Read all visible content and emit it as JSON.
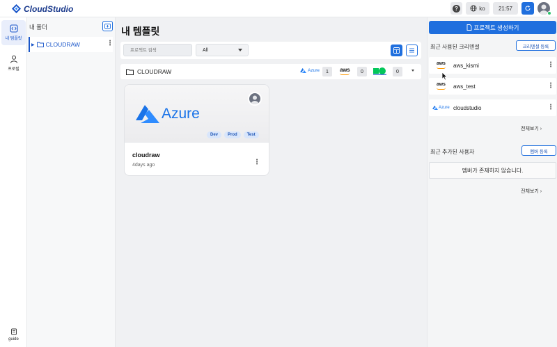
{
  "app": {
    "name": "CloudStudio"
  },
  "header": {
    "help_icon_text": "?",
    "language": "ko",
    "time": "21:57"
  },
  "leftnav": {
    "items": [
      {
        "label": "내 템플릿"
      },
      {
        "label": "프로필"
      }
    ],
    "guide_label": "guide"
  },
  "folders": {
    "title": "내 폴더",
    "items": [
      {
        "name": "CLOUDRAW"
      }
    ]
  },
  "main": {
    "title": "내 템플릿",
    "search_placeholder": "프로젝트 검색",
    "filter_value": "All",
    "folder_row": {
      "name": "CLOUDRAW",
      "providers": [
        {
          "name": "Azure",
          "count": "1"
        },
        {
          "name": "aws",
          "count": "0"
        },
        {
          "name": "ncp",
          "count": "0"
        }
      ]
    },
    "card": {
      "provider_label": "Azure",
      "tags": [
        "Dev",
        "Prod",
        "Test"
      ],
      "name": "cloudraw",
      "time": "4days ago"
    }
  },
  "right": {
    "create_button": "프로젝트 생성하기",
    "cred_section_title": "최근 사용된 크리덴셜",
    "cred_add_button": "크리덴셜 등록",
    "credentials": [
      {
        "provider": "aws",
        "name": "aws_kismi"
      },
      {
        "provider": "aws",
        "name": "aws_test"
      },
      {
        "provider": "Azure",
        "name": "cloudstudio"
      }
    ],
    "see_all": "전체보기 ›",
    "member_section_title": "최근 추가된 사용자",
    "member_add_button": "멤버 등록",
    "member_empty": "멤버가 존재하지 않습니다.",
    "see_all_2": "전체보기 ›"
  },
  "colors": {
    "primary": "#1f6fde",
    "azure": "#1a73e8",
    "aws_orange": "#ff9900",
    "ncp_green": "#03c75a"
  }
}
